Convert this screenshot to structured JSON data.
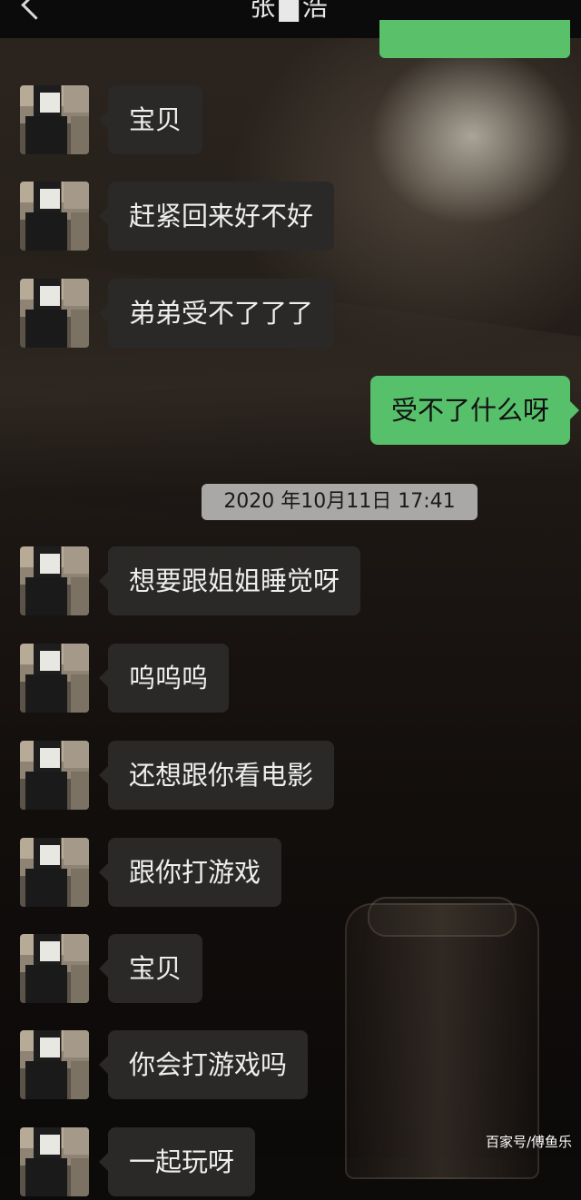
{
  "header": {
    "title": "张▇浩"
  },
  "messages": [
    {
      "side": "received",
      "text": "宝贝"
    },
    {
      "side": "received",
      "text": "赶紧回来好不好"
    },
    {
      "side": "received",
      "text": "弟弟受不了了了"
    },
    {
      "side": "sent",
      "text": "受不了什么呀"
    },
    {
      "side": "time",
      "text": "2020 年10月11日 17:41"
    },
    {
      "side": "received",
      "text": "想要跟姐姐睡觉呀"
    },
    {
      "side": "received",
      "text": "呜呜呜"
    },
    {
      "side": "received",
      "text": "还想跟你看电影"
    },
    {
      "side": "received",
      "text": "跟你打游戏"
    },
    {
      "side": "received",
      "text": "宝贝"
    },
    {
      "side": "received",
      "text": "你会打游戏吗"
    },
    {
      "side": "received",
      "text": "一起玩呀"
    }
  ],
  "watermark": "百家号/傅鱼乐",
  "colors": {
    "sent_bubble": "#57c06b",
    "received_bubble": "#2a2928",
    "header_bg": "#0b0b0b"
  },
  "icons": [
    "back-chevron-icon"
  ]
}
